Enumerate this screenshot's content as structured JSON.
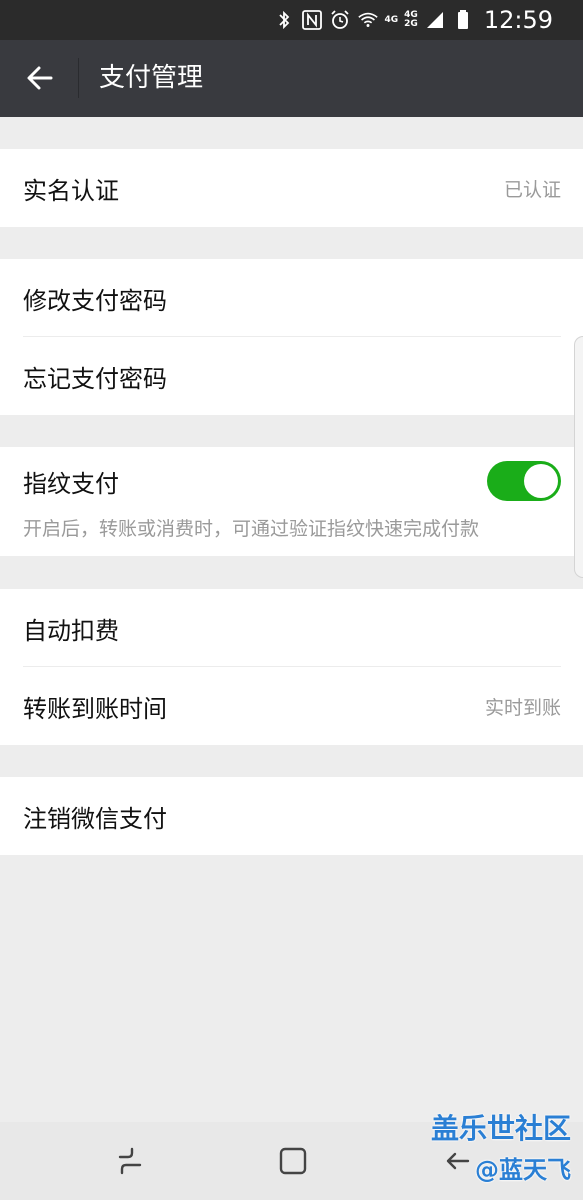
{
  "status_bar": {
    "time": "12:59",
    "net_top": "4G",
    "net_sub1": "4G",
    "net_sub2": "2G"
  },
  "header": {
    "title": "支付管理"
  },
  "sections": {
    "verification": {
      "label": "实名认证",
      "value": "已认证"
    },
    "password": {
      "change_label": "修改支付密码",
      "forget_label": "忘记支付密码"
    },
    "fingerprint": {
      "label": "指纹支付",
      "enabled": true,
      "description": "开启后，转账或消费时，可通过验证指纹快速完成付款"
    },
    "billing": {
      "auto_deduct_label": "自动扣费",
      "transfer_time_label": "转账到账时间",
      "transfer_time_value": "实时到账"
    },
    "deactivate": {
      "label": "注销微信支付"
    }
  },
  "watermark": {
    "line1": "盖乐世社区",
    "line2": "@蓝天飞"
  },
  "colors": {
    "title_bar": "#393a3f",
    "status_bar": "#2b2b2b",
    "toggle_on": "#1aad19",
    "background": "#ededed"
  }
}
